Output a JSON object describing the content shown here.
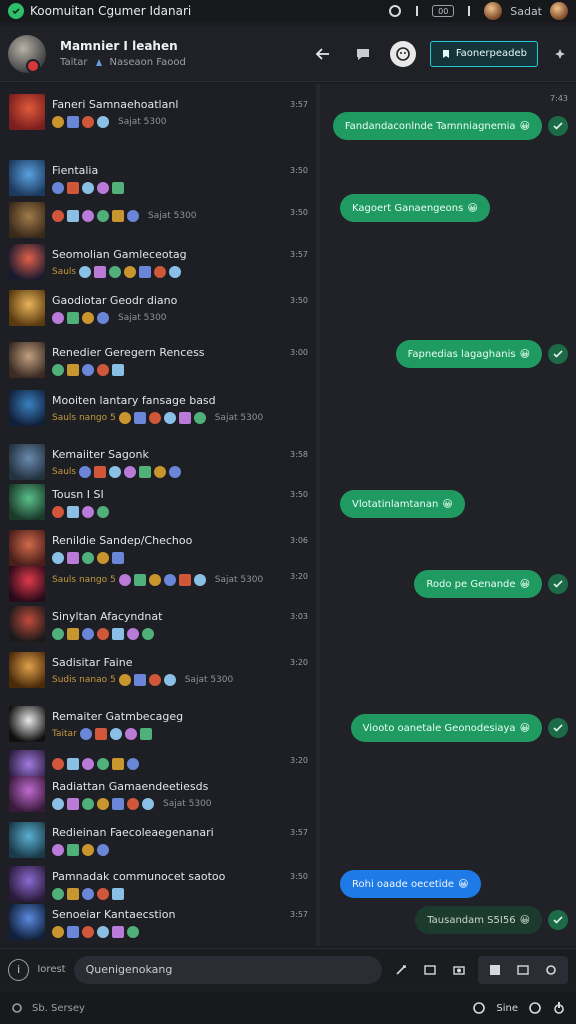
{
  "window": {
    "title": "Koomuitan Cgumer Idanari",
    "status_label": "Sadat",
    "pill": "00"
  },
  "header": {
    "name": "Mamnier I leahen",
    "sub_left": "Taitar",
    "sub_right": "Naseaon Faood",
    "cta_label": "Faonerpeadeb"
  },
  "list": [
    {
      "title": "Faneri Samnaehoatlanl",
      "time": "3:57",
      "meta": "Sajat 5300",
      "prefix": ""
    },
    {
      "title": "Fientalia",
      "time": "3:50",
      "meta": "",
      "prefix": ""
    },
    {
      "title": "",
      "time": "3:50",
      "meta": "Sajat 5300",
      "prefix": ""
    },
    {
      "title": "Seomolian Gamleceotag",
      "time": "3:57",
      "meta": "",
      "prefix": "Sauls"
    },
    {
      "title": "Gaodiotar Geodr diano",
      "time": "3:50",
      "meta": "Sajat 5300",
      "prefix": ""
    },
    {
      "title": "Renedier Geregern Rencess",
      "time": "3:00",
      "meta": "",
      "prefix": ""
    },
    {
      "title": "Mooiten lantary fansage basd",
      "time": "",
      "meta": "Sajat 5300",
      "prefix": "Sauls nango 5"
    },
    {
      "title": "Kemaiiter Sagonk",
      "time": "3:58",
      "meta": "",
      "prefix": "Sauls"
    },
    {
      "title": "Tousn I SI",
      "time": "3:50",
      "meta": "",
      "prefix": ""
    },
    {
      "title": "Renildie Sandep/Chechoo",
      "time": "3:06",
      "meta": "",
      "prefix": ""
    },
    {
      "title": "",
      "time": "3:20",
      "meta": "Sajat 5300",
      "prefix": "Sauls nango 5"
    },
    {
      "title": "Sinyltan Afacyndnat",
      "time": "3:03",
      "meta": "",
      "prefix": ""
    },
    {
      "title": "Sadisitar Faine",
      "time": "3:20",
      "meta": "Sajat 5300",
      "prefix": "Sudis nanao 5"
    },
    {
      "title": "Remaiter Gatmbecageg",
      "time": "",
      "meta": "",
      "prefix": "Taitar"
    },
    {
      "title": "",
      "time": "3:20",
      "meta": "",
      "prefix": ""
    },
    {
      "title": "Radiattan Gamaendeetiesds",
      "time": "",
      "meta": "Sajat 5300",
      "prefix": ""
    },
    {
      "title": "Redieinan Faecoleaegenanari",
      "time": "3:57",
      "meta": "",
      "prefix": ""
    },
    {
      "title": "Pamnadak communocet saotoo",
      "time": "3:50",
      "meta": "",
      "prefix": ""
    },
    {
      "title": "Senoeiar Kantaecstion",
      "time": "3:57",
      "meta": "",
      "prefix": ""
    }
  ],
  "chat": {
    "top_time": "7:43",
    "messages": [
      {
        "text": "Fandandaconlnde Tamnniagnemia",
        "side": "right",
        "style": "green"
      },
      {
        "text": "Kagoert Ganaengeons",
        "side": "left",
        "style": "green"
      },
      {
        "text": "Fapnedias lagaghanis",
        "side": "right",
        "style": "green"
      },
      {
        "text": "Vlotatinlamtanan",
        "side": "left",
        "style": "green"
      },
      {
        "text": "Rodo pe Genande",
        "side": "right",
        "style": "green"
      },
      {
        "text": "Viooto oanetale Geonodesiaya",
        "side": "right",
        "style": "green"
      },
      {
        "text": "Rohi oaade oecetide",
        "side": "left",
        "style": "blue"
      },
      {
        "text": "Tausandam S5I56",
        "side": "right",
        "style": "dark"
      }
    ],
    "emoji": "😀"
  },
  "composer": {
    "label": "Iorest",
    "placeholder": "Quenigenokang"
  },
  "statusbar": {
    "left": "Sb. Sersey",
    "right": "Sine"
  },
  "colors": {
    "accent": "#1f9b62",
    "cta": "#24c9d6",
    "blue": "#1e7ae6"
  }
}
